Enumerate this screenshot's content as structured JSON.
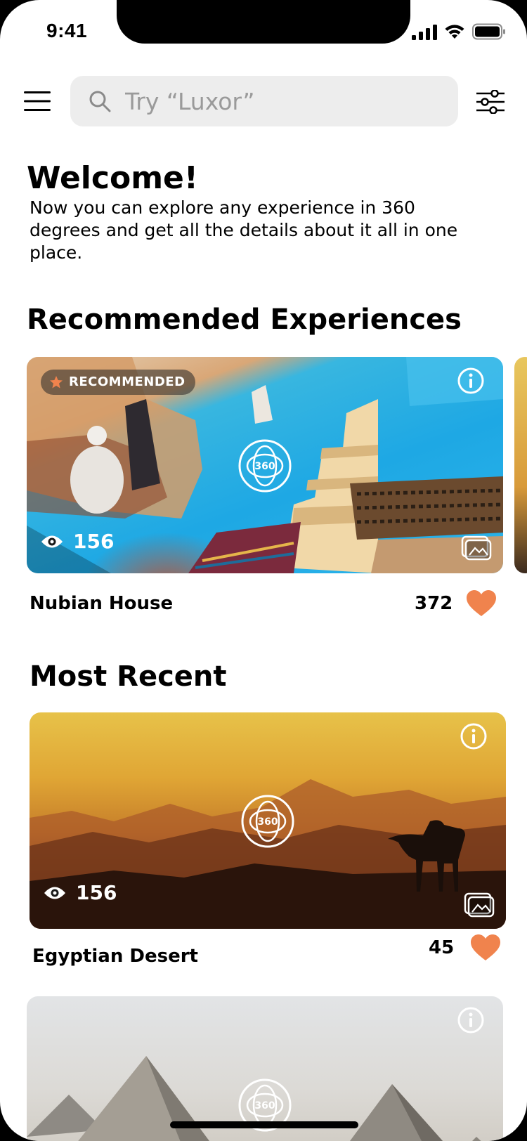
{
  "status_bar": {
    "time": "9:41"
  },
  "search": {
    "placeholder": "Try “Luxor”"
  },
  "welcome": {
    "title": "Welcome!",
    "text": "Now you can explore any experience in 360 degrees and get all the details about it all in one place."
  },
  "sections": {
    "recommended_title": "Recommended Experiences",
    "recent_title": "Most Recent"
  },
  "recommended": [
    {
      "badge": "RECOMMENDED",
      "vr_label": "360",
      "views": "156",
      "title": "Nubian House",
      "likes": "372"
    }
  ],
  "recent": [
    {
      "vr_label": "360",
      "views": "156",
      "title": "Egyptian Desert",
      "likes": "45"
    },
    {
      "vr_label": "360"
    }
  ],
  "colors": {
    "accent": "#f0834d",
    "search_bg": "#ededed",
    "placeholder": "#9a9a9a"
  },
  "icons": [
    "menu-icon",
    "search-icon",
    "filter-icon",
    "star-icon",
    "info-icon",
    "vr-360-icon",
    "eye-icon",
    "gallery-icon",
    "heart-icon"
  ]
}
